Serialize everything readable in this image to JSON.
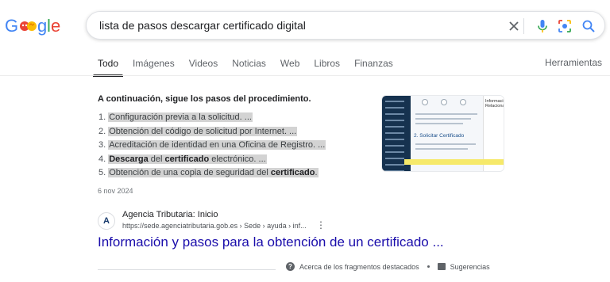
{
  "logo": {
    "alt": "Google"
  },
  "search": {
    "query": "lista de pasos descargar certificado digital",
    "clear_icon": "close-icon",
    "voice_icon": "mic-icon",
    "lens_icon": "lens-icon",
    "search_icon": "search-icon"
  },
  "tabs": [
    {
      "label": "Todo",
      "active": true
    },
    {
      "label": "Imágenes"
    },
    {
      "label": "Videos"
    },
    {
      "label": "Noticias"
    },
    {
      "label": "Web"
    },
    {
      "label": "Libros"
    },
    {
      "label": "Finanzas"
    }
  ],
  "tools_label": "Herramientas",
  "snippet": {
    "heading": "A continuación, sigue los pasos del procedimiento.",
    "steps": [
      {
        "num": "1.",
        "text": "Configuración previa a la solicitud. ..."
      },
      {
        "num": "2.",
        "text": "Obtención del código de solicitud por Internet. ..."
      },
      {
        "num": "3.",
        "text": "Acreditación de identidad en una Oficina de Registro. ..."
      },
      {
        "num": "4.",
        "b1": "Descarga",
        "mid": " del ",
        "b2": "certificado",
        "tail": " electrónico. ..."
      },
      {
        "num": "5.",
        "pre": "Obtención de una copia de seguridad del ",
        "b": "certificado",
        "end": "."
      }
    ],
    "date": "6 nov 2024",
    "thumbnail": {
      "heading": "2. Solicitar Certificado",
      "right_title": "Información Relacionada"
    }
  },
  "result": {
    "favicon_letter": "A",
    "site_name": "Agencia Tributaria: Inicio",
    "url": "https://sede.agenciatributaria.gob.es › Sede › ayuda › inf...",
    "title": "Información y pasos para la obtención de un certificado ..."
  },
  "footer": {
    "about_label": "Acerca de los fragmentos destacados",
    "feedback_label": "Sugerencias"
  },
  "colors": {
    "link": "#1a0dab",
    "highlight": "#d3d3d3",
    "accent_blue": "#4285f4",
    "accent_red": "#ea4335",
    "accent_yellow": "#fbbc05",
    "accent_green": "#34a853"
  }
}
